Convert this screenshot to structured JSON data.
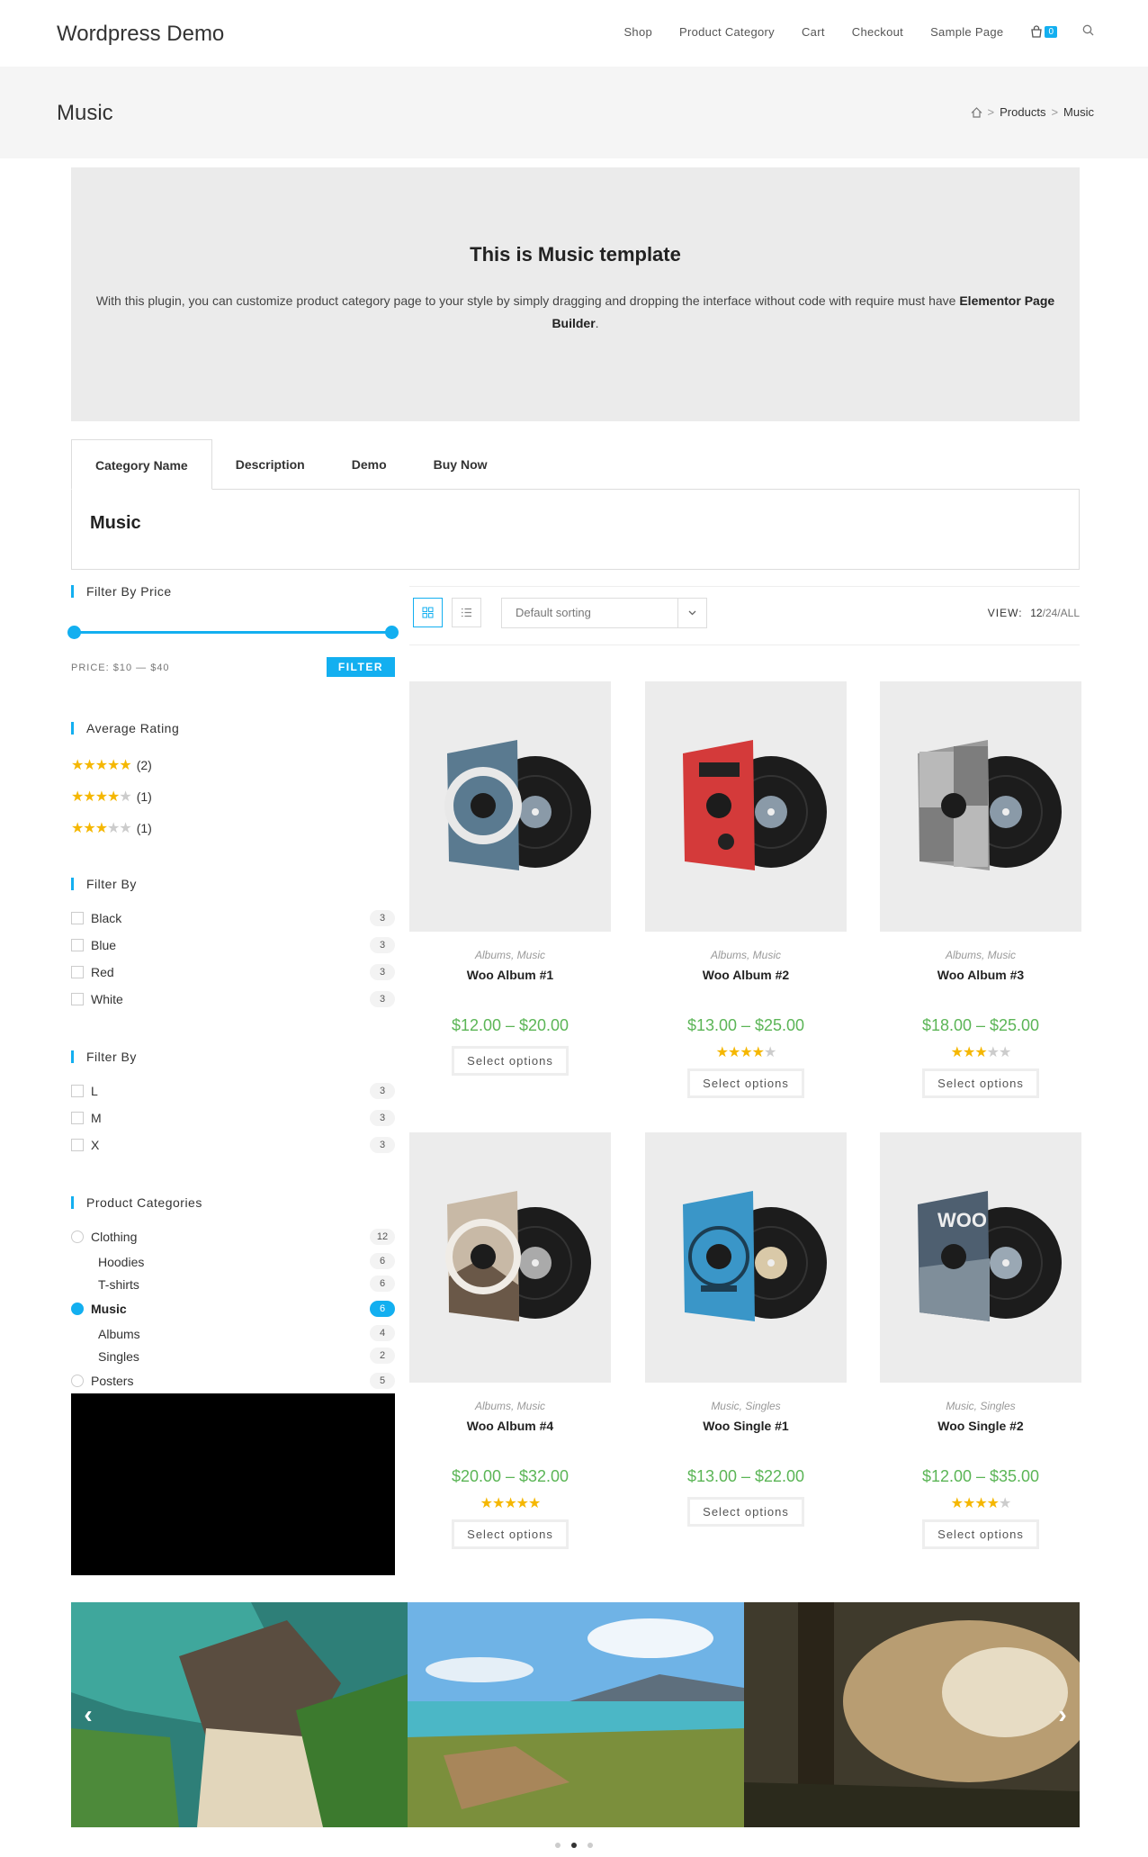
{
  "site": {
    "title": "Wordpress Demo"
  },
  "nav": {
    "items": [
      "Shop",
      "Product Category",
      "Cart",
      "Checkout",
      "Sample Page"
    ],
    "cart_count": "0"
  },
  "page": {
    "title": "Music",
    "breadcrumb": [
      "Products",
      "Music"
    ]
  },
  "hero": {
    "heading": "This is Music template",
    "text": "With this plugin, you can customize product category page to your style by simply dragging and dropping the interface without code with require must have ",
    "text_bold": "Elementor Page Builder",
    "text_end": "."
  },
  "tabs": {
    "items": [
      "Category Name",
      "Description",
      "Demo",
      "Buy Now"
    ],
    "panel_title": "Music"
  },
  "sidebar": {
    "price_title": "Filter By Price",
    "price_label": "PRICE: $10 — $40",
    "filter_button": "FILTER",
    "rating_title": "Average Rating",
    "ratings": [
      {
        "stars": 5,
        "count": "(2)"
      },
      {
        "stars": 4,
        "count": "(1)"
      },
      {
        "stars": 3,
        "count": "(1)"
      }
    ],
    "color_title": "Filter By",
    "colors": [
      {
        "label": "Black",
        "count": "3"
      },
      {
        "label": "Blue",
        "count": "3"
      },
      {
        "label": "Red",
        "count": "3"
      },
      {
        "label": "White",
        "count": "3"
      }
    ],
    "size_title": "Filter By",
    "sizes": [
      {
        "label": "L",
        "count": "3"
      },
      {
        "label": "M",
        "count": "3"
      },
      {
        "label": "X",
        "count": "3"
      }
    ],
    "categories_title": "Product Categories",
    "categories": [
      {
        "label": "Clothing",
        "count": "12"
      },
      {
        "label": "Hoodies",
        "count": "6"
      },
      {
        "label": "T-shirts",
        "count": "6"
      },
      {
        "label": "Music",
        "count": "6"
      },
      {
        "label": "Albums",
        "count": "4"
      },
      {
        "label": "Singles",
        "count": "2"
      },
      {
        "label": "Posters",
        "count": "5"
      }
    ]
  },
  "toolbar": {
    "sort_value": "Default sorting",
    "view_label": "VIEW:",
    "view_options": [
      "12",
      "24",
      "ALL"
    ]
  },
  "products": [
    {
      "cats": "Albums, Music",
      "name": "Woo Album #1",
      "price": "$12.00 – $20.00",
      "rating": 0,
      "button": "Select options"
    },
    {
      "cats": "Albums, Music",
      "name": "Woo Album #2",
      "price": "$13.00 – $25.00",
      "rating": 4,
      "button": "Select options"
    },
    {
      "cats": "Albums, Music",
      "name": "Woo Album #3",
      "price": "$18.00 – $25.00",
      "rating": 3,
      "button": "Select options"
    },
    {
      "cats": "Albums, Music",
      "name": "Woo Album #4",
      "price": "$20.00 – $32.00",
      "rating": 5,
      "button": "Select options"
    },
    {
      "cats": "Music, Singles",
      "name": "Woo Single #1",
      "price": "$13.00 – $22.00",
      "rating": 0,
      "button": "Select options"
    },
    {
      "cats": "Music, Singles",
      "name": "Woo Single #2",
      "price": "$12.00 – $35.00",
      "rating": 4.5,
      "button": "Select options"
    }
  ],
  "colors": {
    "accent": "#13aff0",
    "price": "#5bb556",
    "star": "#f5b700"
  }
}
